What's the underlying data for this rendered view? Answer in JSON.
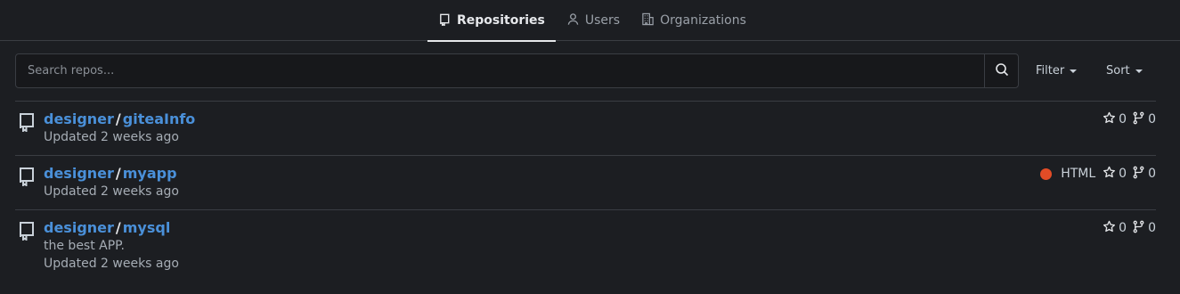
{
  "tabs": [
    {
      "label": "Repositories",
      "icon": "repo-icon",
      "active": true
    },
    {
      "label": "Users",
      "icon": "user-icon",
      "active": false
    },
    {
      "label": "Organizations",
      "icon": "organization-icon",
      "active": false
    }
  ],
  "search": {
    "placeholder": "Search repos...",
    "value": ""
  },
  "filter": {
    "label": "Filter"
  },
  "sort": {
    "label": "Sort"
  },
  "repos": [
    {
      "owner": "designer",
      "name": "giteaInfo",
      "description": "",
      "updated": "Updated 2 weeks ago",
      "language": "",
      "language_color": "",
      "stars": "0",
      "forks": "0"
    },
    {
      "owner": "designer",
      "name": "myapp",
      "description": "",
      "updated": "Updated 2 weeks ago",
      "language": "HTML",
      "language_color": "#e34c26",
      "stars": "0",
      "forks": "0"
    },
    {
      "owner": "designer",
      "name": "mysql",
      "description": "the best APP.",
      "updated": "Updated 2 weeks ago",
      "language": "",
      "language_color": "",
      "stars": "0",
      "forks": "0"
    }
  ],
  "colors": {
    "background": "#1c1e22",
    "link": "#4a90d9",
    "border": "#3a3d43"
  }
}
